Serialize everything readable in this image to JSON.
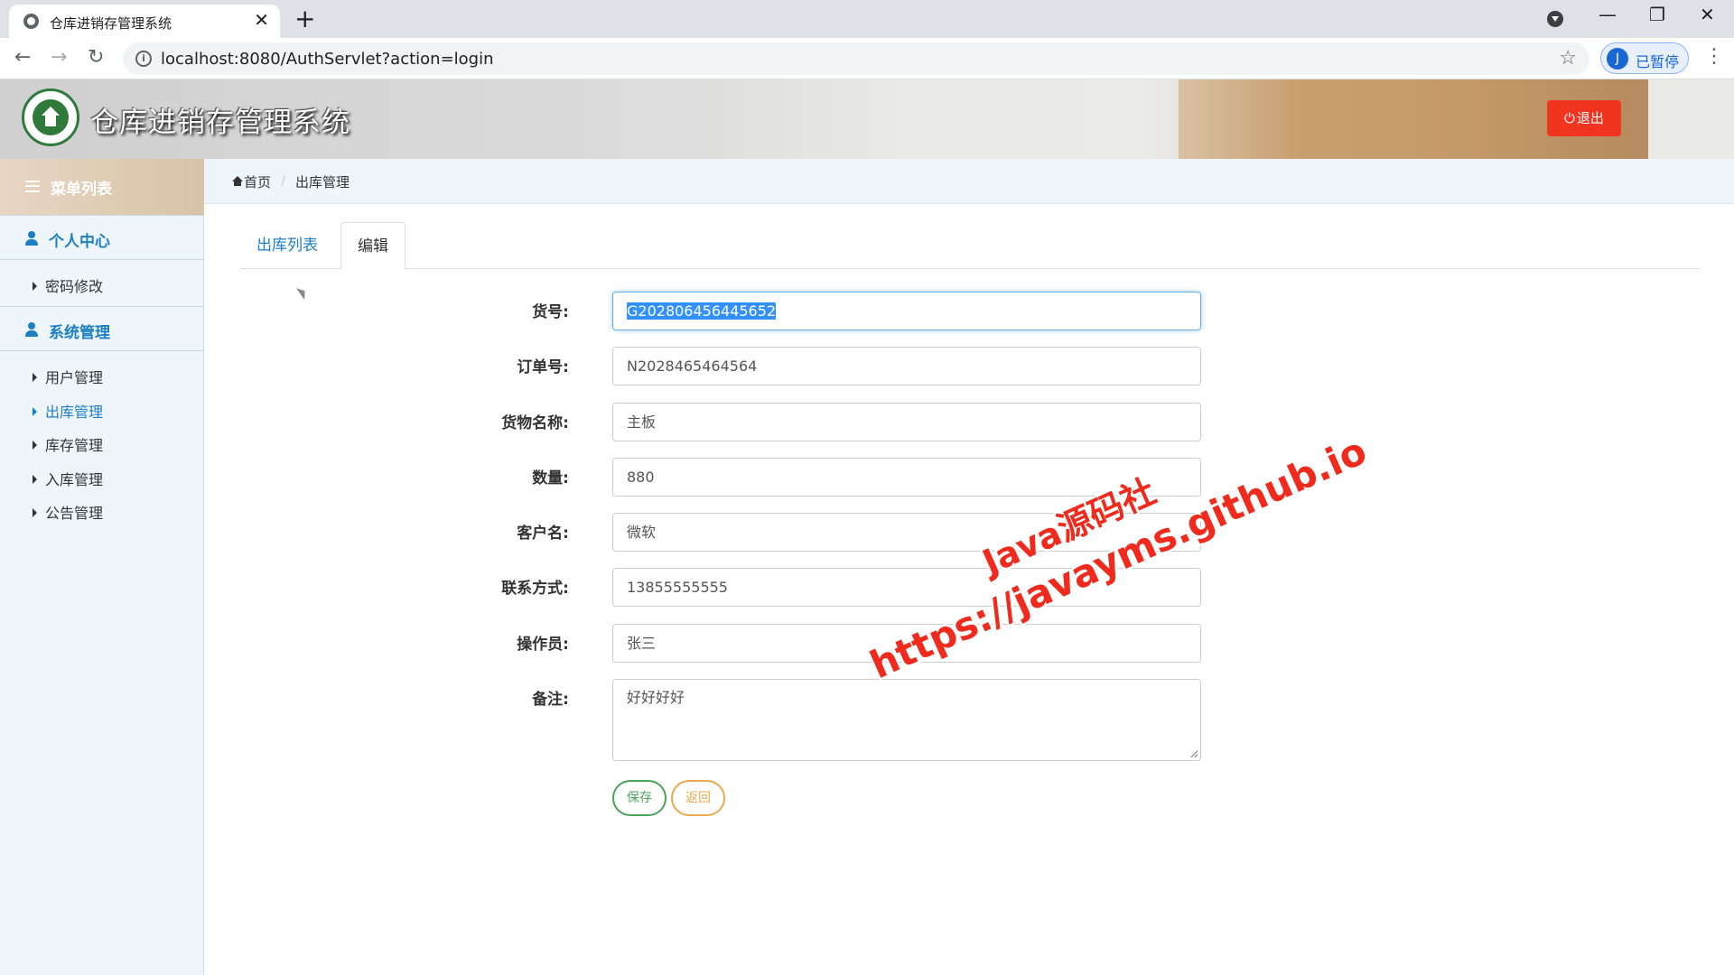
{
  "browser": {
    "tab_title": "仓库进销存管理系统",
    "url": "localhost:8080/AuthServlet?action=login",
    "profile_initial": "J",
    "profile_status": "已暂停",
    "new_tab_glyph": "+",
    "close_glyph": "✕",
    "minimize_glyph": "—",
    "restore_glyph": "❐",
    "window_close_glyph": "✕",
    "back_glyph": "←",
    "forward_glyph": "→",
    "reload_glyph": "↻",
    "star_glyph": "☆",
    "kebab_glyph": "⋮"
  },
  "header": {
    "app_title": "仓库进销存管理系统",
    "logout_label": "退出",
    "logout_icon": "⏻"
  },
  "sidebar": {
    "menu_title": "菜单列表",
    "sections": [
      {
        "label": "个人中心",
        "items": [
          {
            "label": "密码修改"
          }
        ]
      },
      {
        "label": "系统管理",
        "items": [
          {
            "label": "用户管理"
          },
          {
            "label": "出库管理",
            "active": true
          },
          {
            "label": "库存管理"
          },
          {
            "label": "入库管理"
          },
          {
            "label": "公告管理"
          }
        ]
      }
    ]
  },
  "breadcrumb": {
    "home": "首页",
    "current": "出库管理"
  },
  "tabs": [
    {
      "label": "出库列表"
    },
    {
      "label": "编辑",
      "active": true
    }
  ],
  "form": {
    "fields": [
      {
        "label": "货号:",
        "value": "G202806456445652"
      },
      {
        "label": "订单号:",
        "value": "N2028465464564"
      },
      {
        "label": "货物名称:",
        "value": "主板"
      },
      {
        "label": "数量:",
        "value": "880"
      },
      {
        "label": "客户名:",
        "value": "微软"
      },
      {
        "label": "联系方式:",
        "value": "13855555555"
      },
      {
        "label": "操作员:",
        "value": "张三"
      },
      {
        "label": "备注:",
        "value": "好好好好"
      }
    ],
    "save_label": "保存",
    "back_label": "返回"
  },
  "watermark": {
    "line1": "Java源码社",
    "line2": "https://javayms.github.io"
  },
  "colors": {
    "accent": "#1c7fc1",
    "logout": "#f0341f",
    "save": "#4aa35a",
    "back": "#eba94b",
    "watermark": "#f02a1d"
  }
}
